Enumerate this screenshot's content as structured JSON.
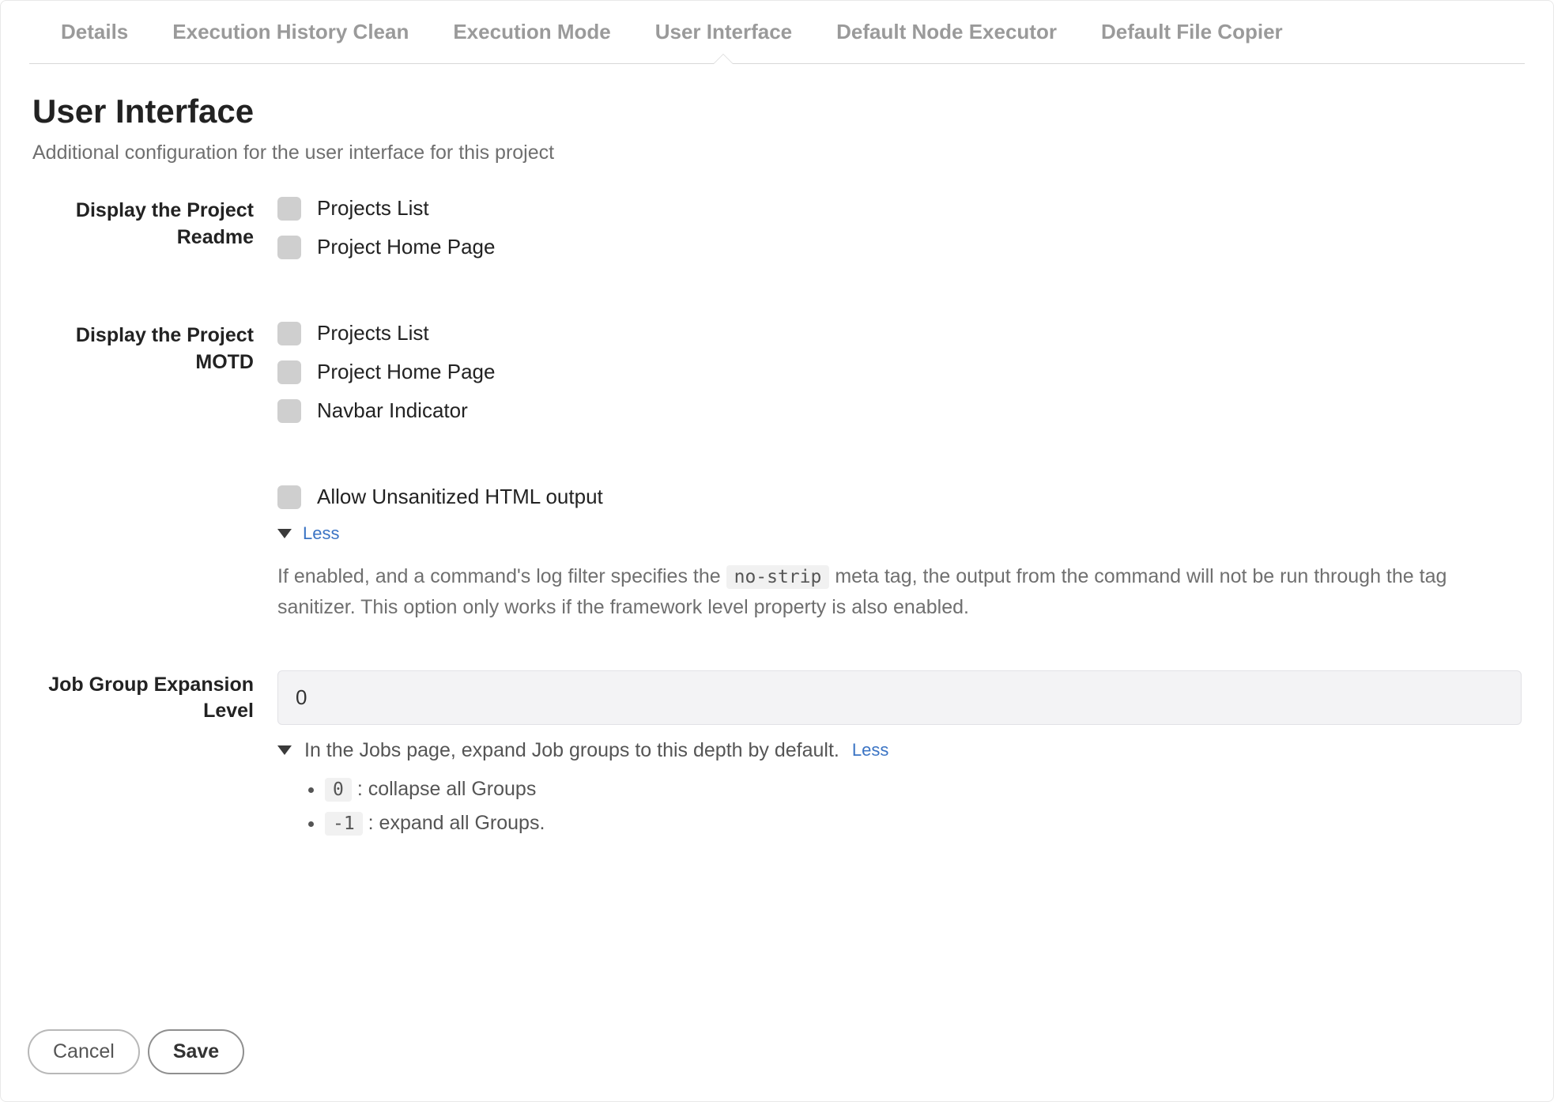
{
  "tabs": [
    {
      "label": "Details",
      "active": false
    },
    {
      "label": "Execution History Clean",
      "active": false
    },
    {
      "label": "Execution Mode",
      "active": false
    },
    {
      "label": "User Interface",
      "active": true
    },
    {
      "label": "Default Node Executor",
      "active": false
    },
    {
      "label": "Default File Copier",
      "active": false
    }
  ],
  "section": {
    "title": "User Interface",
    "subtitle": "Additional configuration for the user interface for this project"
  },
  "readme": {
    "label": "Display the Project Readme",
    "options": [
      "Projects List",
      "Project Home Page"
    ]
  },
  "motd": {
    "label": "Display the Project MOTD",
    "options": [
      "Projects List",
      "Project Home Page",
      "Navbar Indicator"
    ]
  },
  "unsanitized": {
    "checkbox_label": "Allow Unsanitized HTML output",
    "toggle_label": "Less",
    "help_pre": "If enabled, and a command's log filter specifies the ",
    "help_tag": "no-strip",
    "help_post": " meta tag, the output from the command will not be run through the tag sanitizer. This option only works if the framework level property is also enabled."
  },
  "job_group": {
    "label": "Job Group Expansion Level",
    "value": "0",
    "hint": "In the Jobs page, expand Job groups to this depth by default.",
    "toggle_label": "Less",
    "values": [
      {
        "code": "0",
        "desc": " : collapse all Groups"
      },
      {
        "code": "-1",
        "desc": " : expand all Groups."
      }
    ]
  },
  "footer": {
    "cancel": "Cancel",
    "save": "Save"
  }
}
